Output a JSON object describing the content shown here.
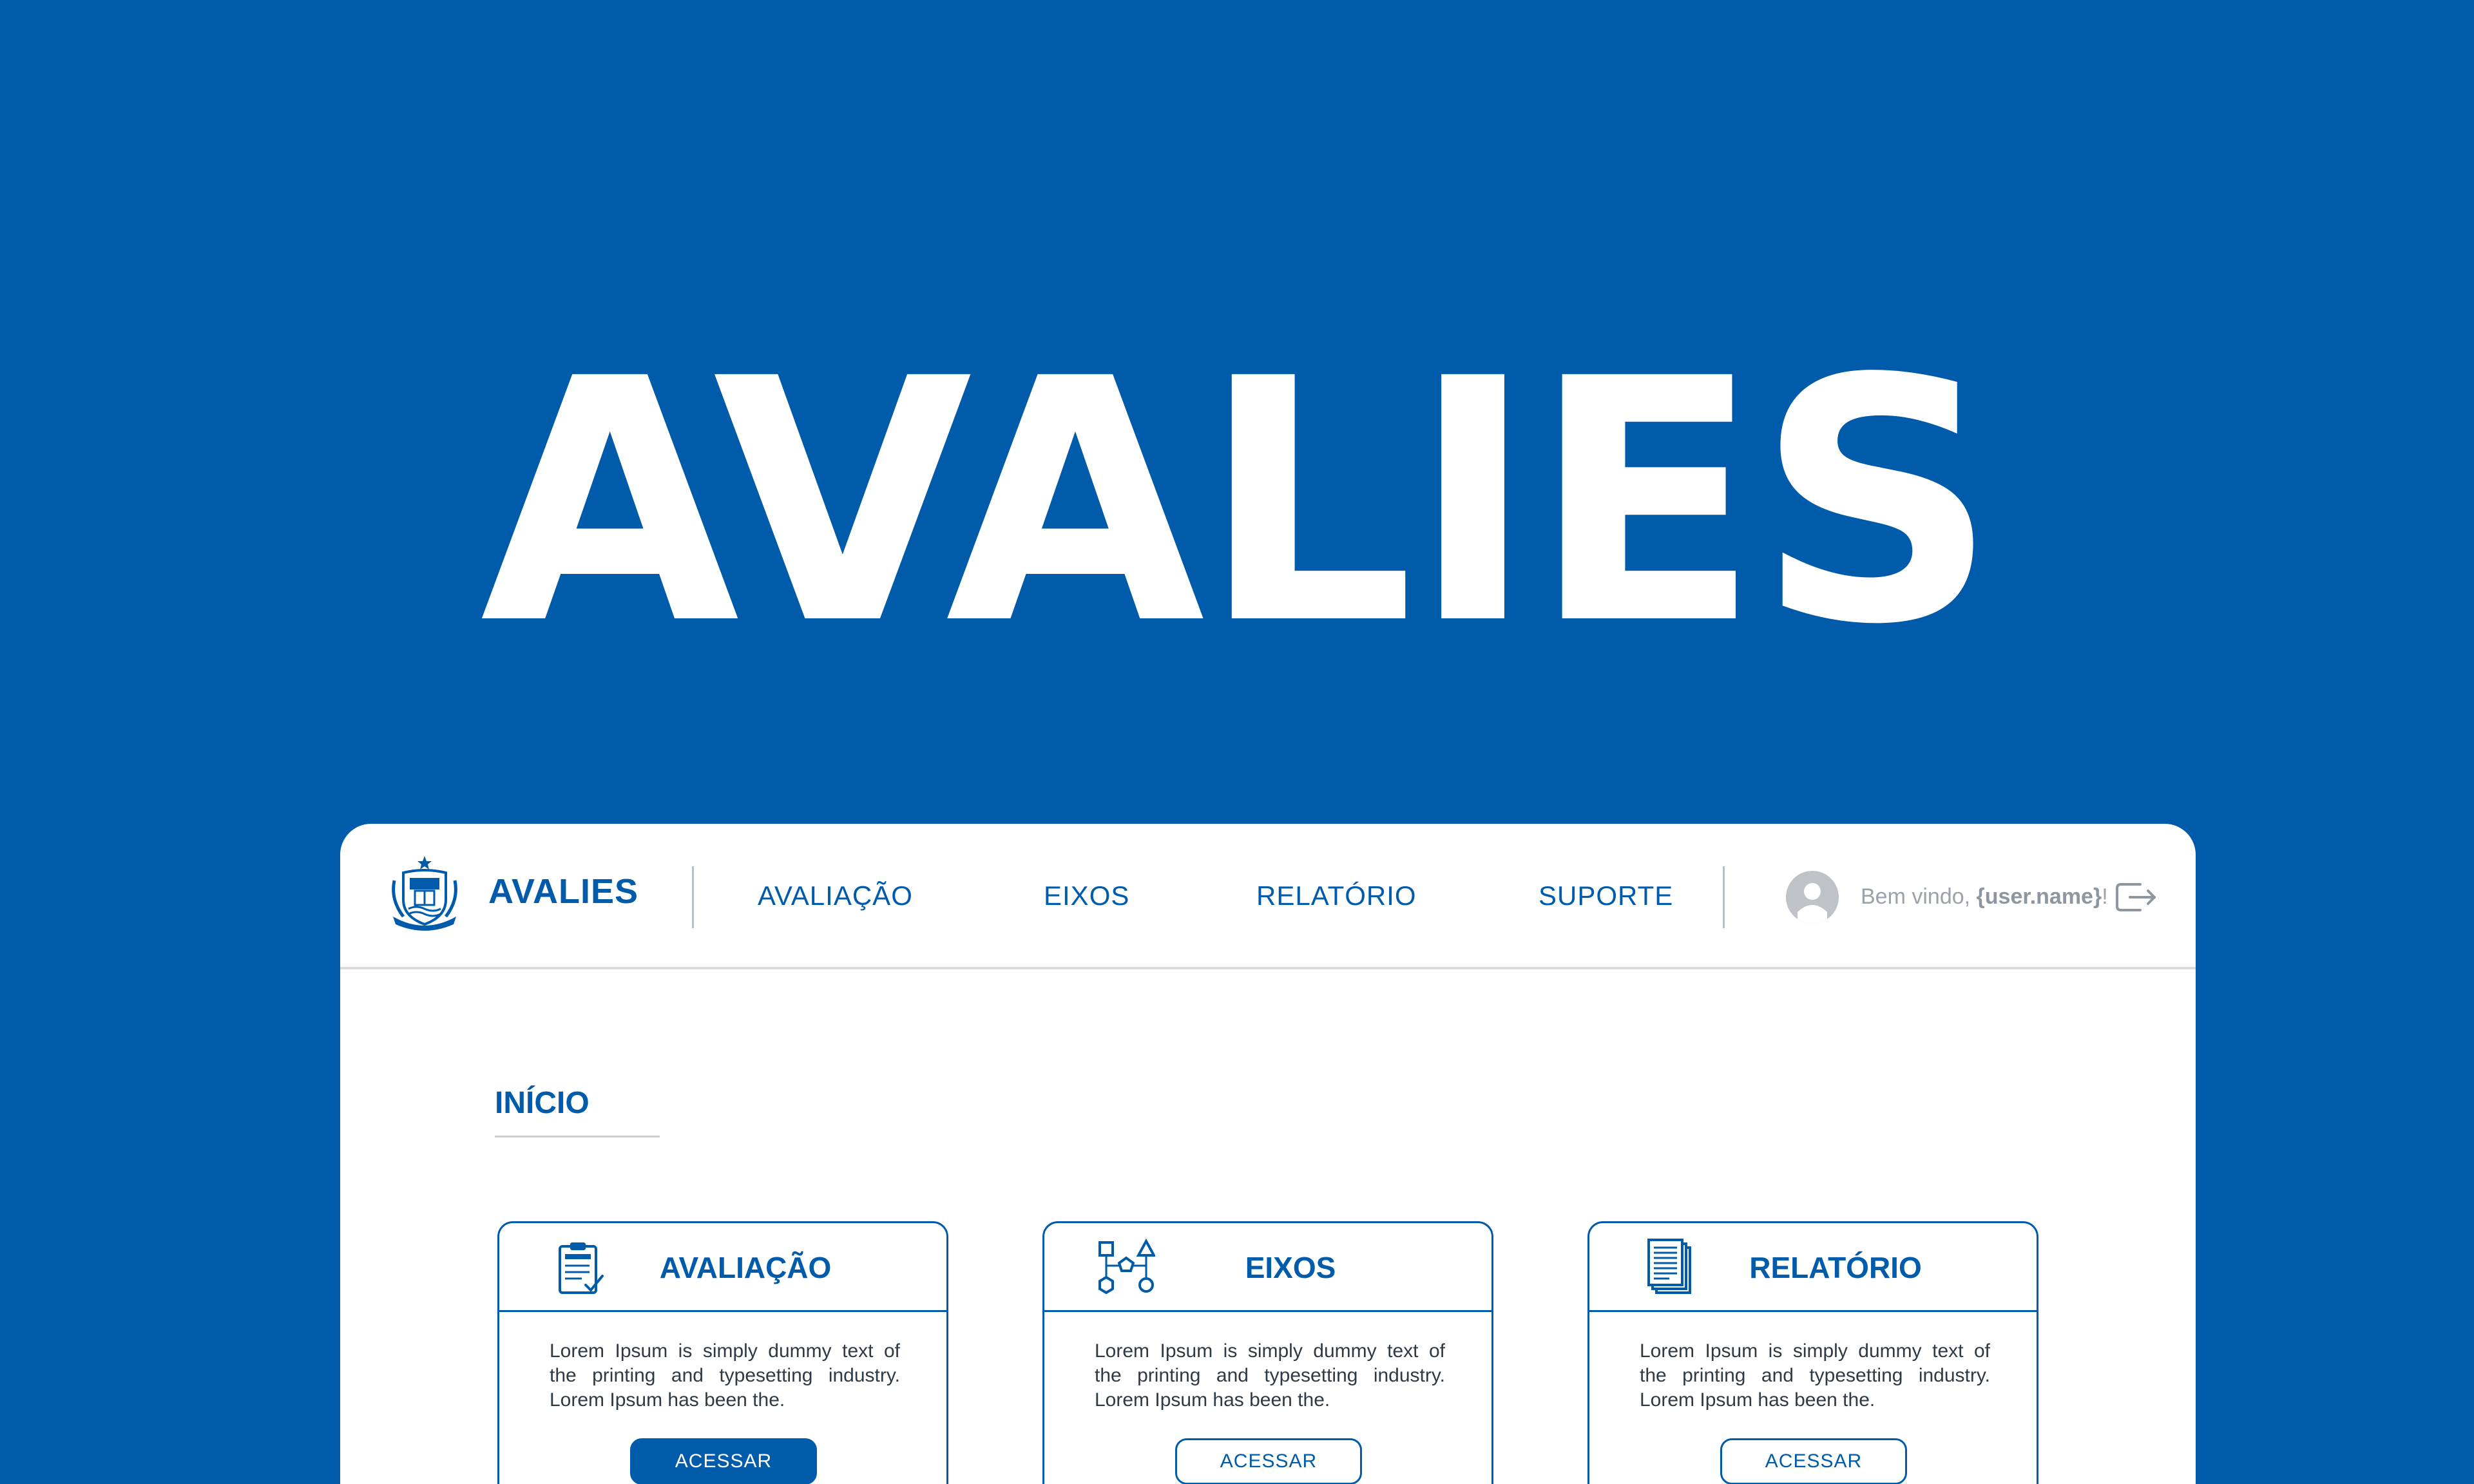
{
  "hero": {
    "title": "AVALIES"
  },
  "navbar": {
    "brand": "AVALIES",
    "items": [
      {
        "label": "AVALIAÇÃO"
      },
      {
        "label": "EIXOS"
      },
      {
        "label": "RELATÓRIO"
      },
      {
        "label": "SUPORTE"
      }
    ],
    "welcome_prefix": "Bem vindo, ",
    "user_name": "{user.name}",
    "welcome_suffix": "!"
  },
  "main": {
    "section_title": "INÍCIO",
    "cards": [
      {
        "title": "AVALIAÇÃO",
        "icon": "clipboard-icon",
        "text": "Lorem Ipsum is simply dummy text of the printing and typesetting industry. Lorem Ipsum has been the.",
        "button": "ACESSAR",
        "button_style": "solid"
      },
      {
        "title": "EIXOS",
        "icon": "shapes-diagram-icon",
        "text": "Lorem Ipsum is simply dummy text of the printing and typesetting industry. Lorem Ipsum has been the.",
        "button": "ACESSAR",
        "button_style": "outline"
      },
      {
        "title": "RELATÓRIO",
        "icon": "documents-icon",
        "text": "Lorem Ipsum is simply dummy text of the printing and typesetting industry. Lorem Ipsum has been the.",
        "button": "ACESSAR",
        "button_style": "outline"
      }
    ]
  },
  "colors": {
    "brand_blue": "#005BAA",
    "white": "#FFFFFF",
    "muted_gray": "#9AA2AB"
  }
}
